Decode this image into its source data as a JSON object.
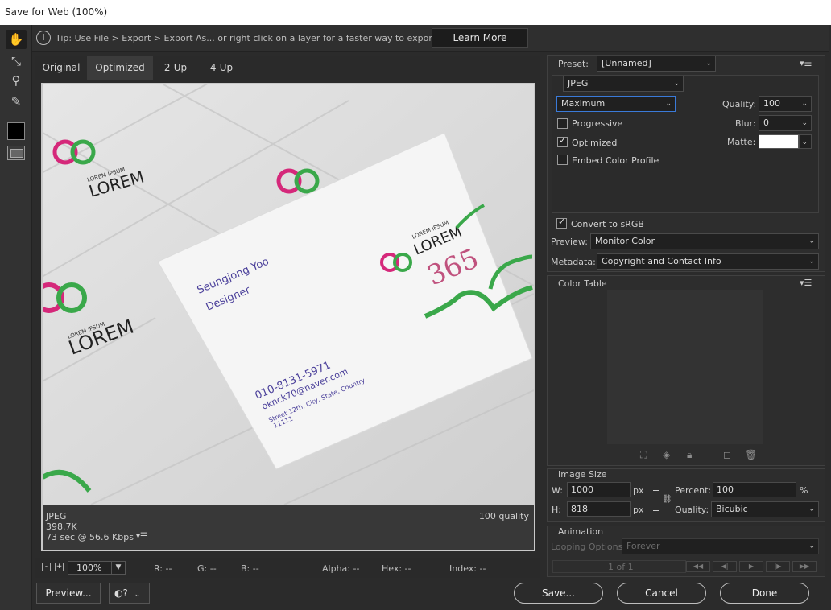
{
  "window": {
    "title": "Save for Web (100%)"
  },
  "tip": {
    "text": "Tip: Use File > Export > Export As...  or right click on a layer for a faster way to export assets",
    "learn_more": "Learn More"
  },
  "tabs": [
    {
      "label": "Original"
    },
    {
      "label": "Optimized"
    },
    {
      "label": "2-Up"
    },
    {
      "label": "4-Up"
    }
  ],
  "image": {
    "card_name": "Seungjong Yoo",
    "card_title": "Designer",
    "phone": "010-8131-5971",
    "email": "oknck70@naver.com",
    "address": "Street 12th, City, State, Country",
    "zip": "11111",
    "logo_small": "LOREM IPSUM",
    "logo_big": "LOREM",
    "number": "365"
  },
  "image_info": {
    "format": "JPEG",
    "size": "398.7K",
    "speed": "73 sec @ 56.6 Kbps",
    "quality": "100 quality"
  },
  "status": {
    "zoom": "100%",
    "r": "R: --",
    "g": "G: --",
    "b": "B: --",
    "alpha": "Alpha: --",
    "hex": "Hex: --",
    "index": "Index: --"
  },
  "buttons": {
    "preview": "Preview...",
    "save": "Save...",
    "cancel": "Cancel",
    "done": "Done"
  },
  "settings": {
    "preset_label": "Preset:",
    "preset_value": "[Unnamed]",
    "format": "JPEG",
    "compression": "Maximum",
    "quality_label": "Quality:",
    "quality_value": "100",
    "blur_label": "Blur:",
    "blur_value": "0",
    "matte_label": "Matte:",
    "progressive": {
      "label": "Progressive",
      "checked": false
    },
    "optimized": {
      "label": "Optimized",
      "checked": true
    },
    "embed": {
      "label": "Embed Color Profile",
      "checked": false
    },
    "convert": {
      "label": "Convert to sRGB",
      "checked": true
    },
    "preview_label": "Preview:",
    "preview_value": "Monitor Color",
    "metadata_label": "Metadata:",
    "metadata_value": "Copyright and Contact Info"
  },
  "color_table": {
    "title": "Color Table"
  },
  "image_size": {
    "title": "Image Size",
    "w_label": "W:",
    "w_value": "1000",
    "h_label": "H:",
    "h_value": "818",
    "unit": "px",
    "percent_label": "Percent:",
    "percent_value": "100",
    "percent_unit": "%",
    "quality_label": "Quality:",
    "quality_value": "Bicubic"
  },
  "animation": {
    "title": "Animation",
    "looping_label": "Looping Options:",
    "looping_value": "Forever",
    "frame": "1 of 1"
  },
  "colors": {
    "accent": "#3a7ad8",
    "matte": "#ffffff",
    "magenta": "#d5287a",
    "green": "#3aa84a",
    "ink": "#4a3f9a"
  }
}
